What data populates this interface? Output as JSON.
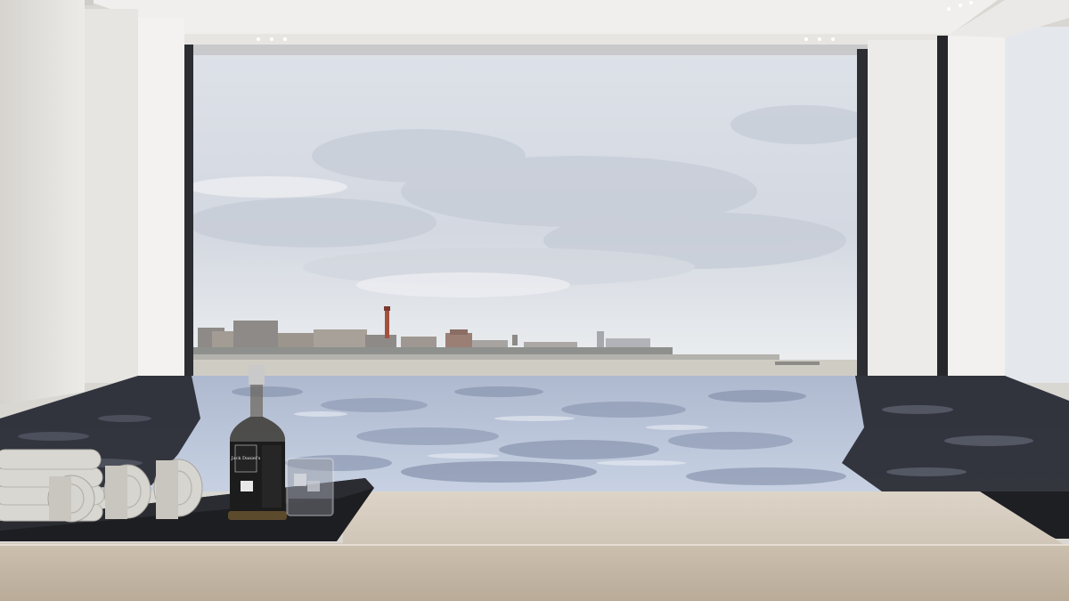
{
  "scene": {
    "colors": {
      "sky_top": "#dfe3ea",
      "sky_bottom": "#eceef0",
      "cloud": "#c9ced8",
      "wall": "#e9e7e3",
      "ceiling": "#f1f0ee",
      "frame": "#2b2d31",
      "water_light": "#b9c6dd",
      "water_dark": "#1d1f26",
      "counter": "#d2c7b9",
      "tray": "#1f2024",
      "towel": "#d8d6d1",
      "bottle_label": "#1c1c1c"
    },
    "bottle": {
      "label_text": "Jack Daniel's"
    },
    "objects": [
      "ceiling-lights",
      "window-frame",
      "city-skyline",
      "lighthouse",
      "infinity-pool",
      "black-tray",
      "rolled-towels",
      "whiskey-bottle",
      "whiskey-glass",
      "wooden-counter"
    ]
  }
}
